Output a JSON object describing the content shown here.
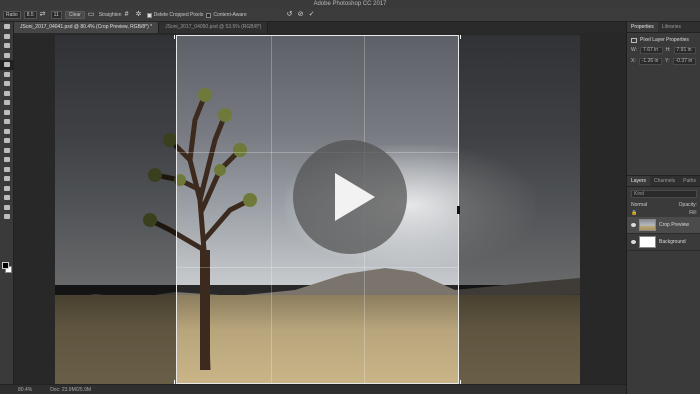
{
  "window": {
    "title": "Adobe Photoshop CC 2017"
  },
  "options": {
    "ratio_label": "Ratio",
    "ratio_w": "8.5",
    "ratio_h": "11",
    "clear_label": "Clear",
    "straighten_label": "Straighten",
    "delete_cropped_label": "Delete Cropped Pixels",
    "delete_cropped_checked": true,
    "content_aware_label": "Content-Aware",
    "content_aware_checked": false
  },
  "tabs": [
    {
      "label": "JSoni_2017_04041.psd @ 80.4% (Crop Preview, RGB/8*) *",
      "active": true
    },
    {
      "label": "JSoni_2017_04050.psd @ 53.5% (RGB/8*)",
      "active": false
    }
  ],
  "status": {
    "zoom": "80.4%",
    "doc": "Doc: 23.9M/25.9M"
  },
  "panels": {
    "properties_tab": "Properties",
    "libraries_tab": "Libraries",
    "properties_title": "Pixel Layer Properties",
    "w_label": "W:",
    "w_value": "7.67 in",
    "h_label": "H:",
    "h_value": "7.91 in",
    "x_label": "X:",
    "x_value": "-1.26 in",
    "y_label": "Y:",
    "y_value": "-0.37 in",
    "layers_tab": "Layers",
    "channels_tab": "Channels",
    "paths_tab": "Paths",
    "kind_placeholder": "Kind",
    "blend_mode": "Normal",
    "opacity_label": "Opacity:",
    "fill_label": "Fill:",
    "layers": [
      {
        "name": "Crop Preview",
        "selected": true,
        "thumb": "photo"
      },
      {
        "name": "Background",
        "selected": false,
        "thumb": "white"
      }
    ]
  },
  "colors": {
    "accent": "#4b4b4b",
    "crop_border": "#e8e8e8"
  }
}
